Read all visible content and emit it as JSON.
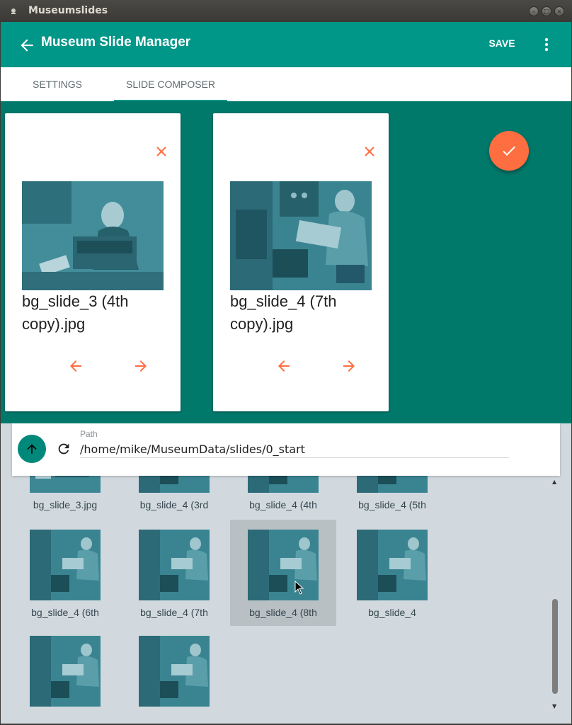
{
  "window": {
    "title": "Museumslides"
  },
  "appbar": {
    "title": "Museum Slide Manager",
    "save_label": "SAVE"
  },
  "tabs": [
    {
      "label": "SETTINGS"
    },
    {
      "label": "SLIDE COMPOSER",
      "active": true
    }
  ],
  "composer": {
    "cards": [
      {
        "title": "bg_slide_3 (4th copy).jpg"
      },
      {
        "title": "bg_slide_4 (7th copy).jpg"
      }
    ]
  },
  "browser": {
    "path_label": "Path",
    "path_value": "/home/mike/MuseumData/slides/0_start",
    "files": [
      {
        "name": "bg_slide_3.jpg"
      },
      {
        "name": "bg_slide_4 (3rd"
      },
      {
        "name": "bg_slide_4 (4th"
      },
      {
        "name": "bg_slide_4 (5th"
      },
      {
        "name": "bg_slide_4 (6th"
      },
      {
        "name": "bg_slide_4 (7th"
      },
      {
        "name": "bg_slide_4 (8th",
        "selected": true
      },
      {
        "name": "bg_slide_4"
      },
      {
        "name": ""
      },
      {
        "name": ""
      }
    ]
  },
  "colors": {
    "primary": "#009688",
    "primary_dark": "#00796b",
    "accent": "#ff6e40",
    "browser_bg": "#d1d9df"
  }
}
